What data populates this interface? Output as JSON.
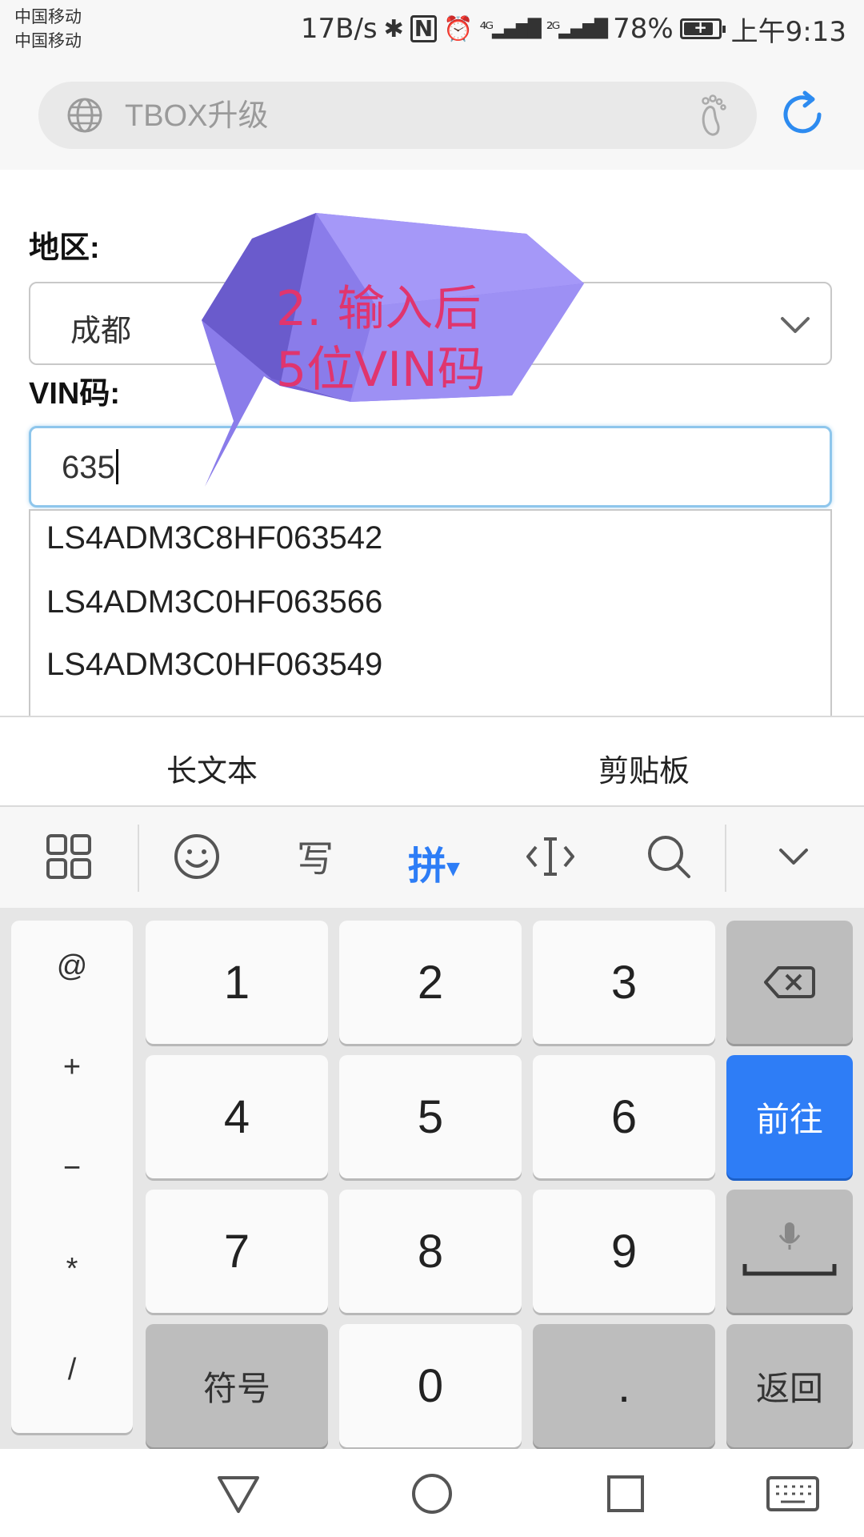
{
  "status_bar": {
    "carrier_1": "中国移动",
    "carrier_2": "中国移动",
    "speed": "17B/s",
    "battery": "78%",
    "time": "上午9:13",
    "icons": [
      "bluetooth-icon",
      "nfc-icon",
      "alarm-icon",
      "signal-4g-icon",
      "signal-2g-icon",
      "battery-icon"
    ]
  },
  "browser": {
    "url": "TBOX升级",
    "icons": [
      "globe-icon",
      "footprint-icon",
      "refresh-icon"
    ]
  },
  "form": {
    "region_label": "地区:",
    "region_value": "成都",
    "vin_label": "VIN码:",
    "vin_value": "635"
  },
  "suggestions": [
    "LS4ADM3C8HF063542",
    "LS4ADM3C0HF063566",
    "LS4ADM3C0HF063549"
  ],
  "annotation": {
    "line1": "2.  输入后",
    "line2": "5位VIN码"
  },
  "keyboard": {
    "strip": {
      "long_text": "长文本",
      "clipboard": "剪贴板"
    },
    "toolbar": {
      "pinyin": "拼"
    },
    "symbols": [
      "@",
      "+",
      "−",
      "*",
      "/"
    ],
    "digits": [
      "1",
      "2",
      "3",
      "4",
      "5",
      "6",
      "7",
      "8",
      "9",
      "0"
    ],
    "symbol_key": "符号",
    "dot_key": ".",
    "go_key": "前往",
    "back_key": "返回",
    "colors": {
      "accent": "#2e7df6",
      "key_gray": "#bdbdbd",
      "annotation_text": "#e0356e",
      "bubble": "#9a8cf0"
    }
  },
  "navbar": {
    "icons": [
      "back-triangle-icon",
      "home-circle-icon",
      "recents-square-icon",
      "keyboard-icon"
    ]
  }
}
